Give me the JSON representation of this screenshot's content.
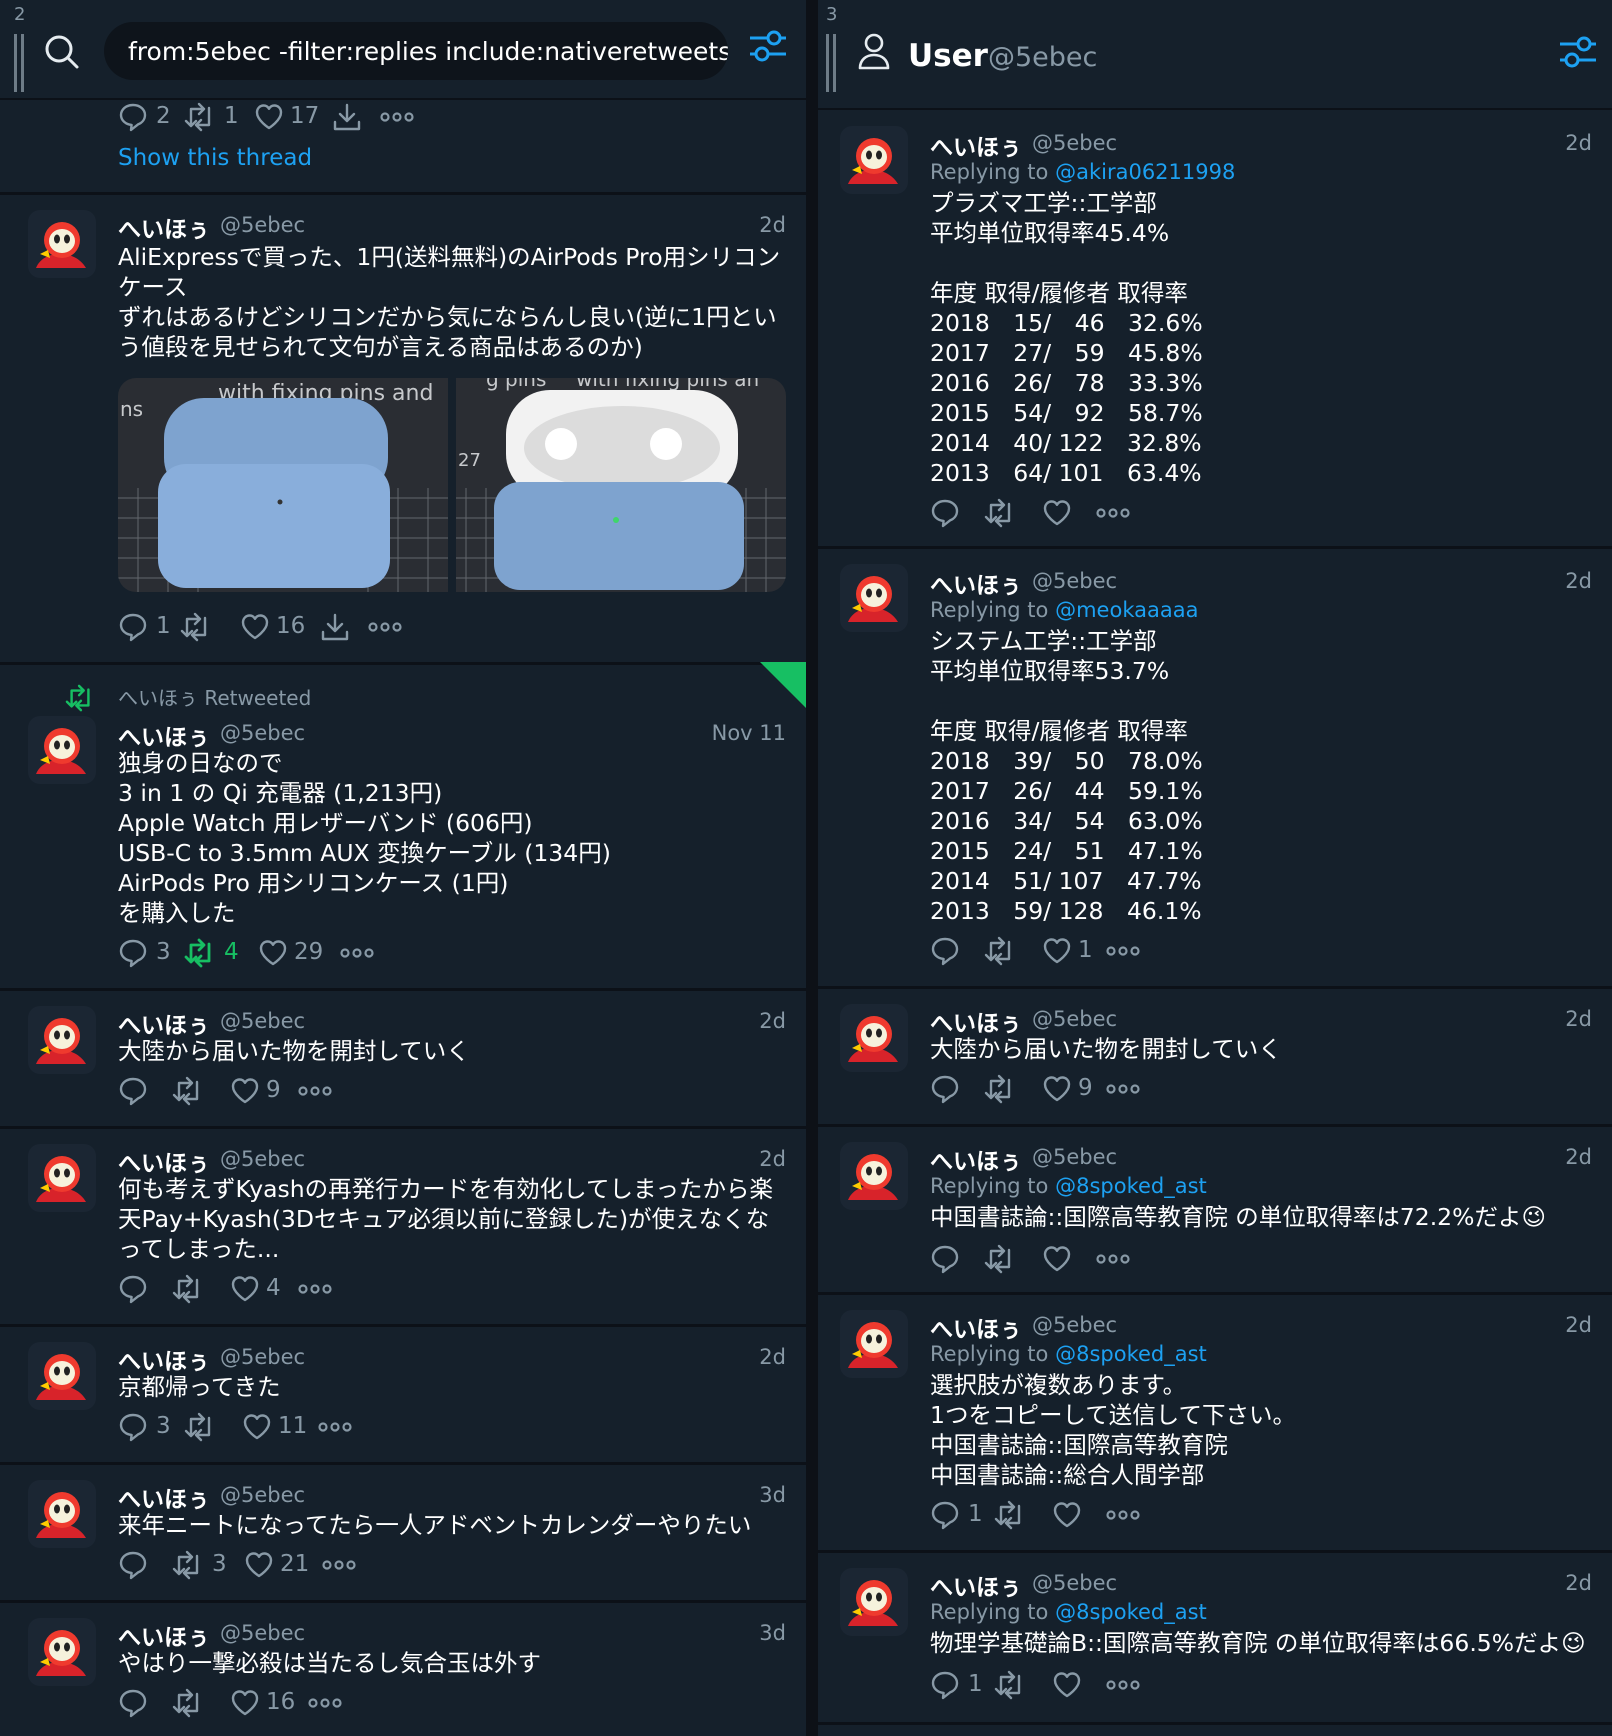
{
  "left_column": {
    "number": "2",
    "search_query": "from:5ebec -filter:replies include:nativeretweets",
    "thread_actions": {
      "reply": "2",
      "retweet": "1",
      "like": "17"
    },
    "show_thread": "Show this thread",
    "tweets": [
      {
        "name": "へいほぅ",
        "handle": "@5ebec",
        "time": "2d",
        "text": "AliExpressで買った、1円(送料無料)のAirPods Pro用シリコンケース\nずれはあるけどシリコンだから気にならんし良い(逆に1円という値段を見せられて文句が言える商品はあるのか)",
        "image_text": [
          "with fixing pins and",
          "ns",
          "g pins",
          "with fixing pins an",
          "27"
        ],
        "reply": "1",
        "retweet": "",
        "like": "16"
      },
      {
        "retweeted_by": "へいほぅ Retweeted",
        "name": "へいほぅ",
        "handle": "@5ebec",
        "time": "Nov 11",
        "text": "独身の日なので\n3 in 1 の Qi 充電器 (1,213円)\nApple Watch 用レザーバンド (606円)\nUSB-C to 3.5mm AUX 変換ケーブル (134円)\nAirPods Pro 用シリコンケース (1円)\nを購入した",
        "reply": "3",
        "retweet": "4",
        "like": "29"
      },
      {
        "name": "へいほぅ",
        "handle": "@5ebec",
        "time": "2d",
        "text": "大陸から届いた物を開封していく",
        "reply": "",
        "retweet": "",
        "like": "9"
      },
      {
        "name": "へいほぅ",
        "handle": "@5ebec",
        "time": "2d",
        "text": "何も考えずKyashの再発行カードを有効化してしまったから楽天Pay+Kyash(3Dセキュア必須以前に登録した)が使えなくなってしまった...",
        "reply": "",
        "retweet": "",
        "like": "4"
      },
      {
        "name": "へいほぅ",
        "handle": "@5ebec",
        "time": "2d",
        "text": "京都帰ってきた",
        "reply": "3",
        "retweet": "",
        "like": "11"
      },
      {
        "name": "へいほぅ",
        "handle": "@5ebec",
        "time": "3d",
        "text": "来年ニートになってたら一人アドベントカレンダーやりたい",
        "reply": "",
        "retweet": "3",
        "like": "21"
      },
      {
        "name": "へいほぅ",
        "handle": "@5ebec",
        "time": "3d",
        "text": "やはり一撃必殺は当たるし気合玉は外す",
        "reply": "",
        "retweet": "",
        "like": "16"
      }
    ]
  },
  "right_column": {
    "number": "3",
    "title": "User",
    "handle": "@5ebec",
    "replying_prefix": "Replying to",
    "tweets": [
      {
        "name": "へいほぅ",
        "handle": "@5ebec",
        "time": "2d",
        "replying_to": "@akira06211998",
        "text": "プラズマ工学::工学部\n平均単位取得率45.4%\n\n年度 取得/履修者 取得率\n2018　15/　46　32.6%\n2017　27/　59　45.8%\n2016　26/　78　33.3%\n2015　54/　92　58.7%\n2014　40/ 122　32.8%\n2013　64/ 101　63.4%",
        "reply": "",
        "retweet": "",
        "like": ""
      },
      {
        "name": "へいほぅ",
        "handle": "@5ebec",
        "time": "2d",
        "replying_to": "@meokaaaaa",
        "text": "システム工学::工学部\n平均単位取得率53.7%\n\n年度 取得/履修者 取得率\n2018　39/　50　78.0%\n2017　26/　44　59.1%\n2016　34/　54　63.0%\n2015　24/　51　47.1%\n2014　51/ 107　47.7%\n2013　59/ 128　46.1%",
        "reply": "",
        "retweet": "",
        "like": "1"
      },
      {
        "name": "へいほぅ",
        "handle": "@5ebec",
        "time": "2d",
        "replying_to": "",
        "text": "大陸から届いた物を開封していく",
        "reply": "",
        "retweet": "",
        "like": "9"
      },
      {
        "name": "へいほぅ",
        "handle": "@5ebec",
        "time": "2d",
        "replying_to": "@8spoked_ast",
        "text": "中国書誌論::国際高等教育院 の単位取得率は72.2%だよ😉",
        "reply": "",
        "retweet": "",
        "like": ""
      },
      {
        "name": "へいほぅ",
        "handle": "@5ebec",
        "time": "2d",
        "replying_to": "@8spoked_ast",
        "text": "選択肢が複数あります。\n1つをコピーして送信して下さい。\n中国書誌論::国際高等教育院\n中国書誌論::総合人間学部",
        "reply": "1",
        "retweet": "",
        "like": ""
      },
      {
        "name": "へいほぅ",
        "handle": "@5ebec",
        "time": "2d",
        "replying_to": "@8spoked_ast",
        "text": "物理学基礎論B::国際高等教育院 の単位取得率は66.5%だよ😉",
        "reply": "1",
        "retweet": "",
        "like": ""
      }
    ]
  },
  "colors": {
    "background": "#15202b",
    "accent": "#1da1f2",
    "retweet_green": "#17bf63",
    "muted": "#8899a6"
  }
}
